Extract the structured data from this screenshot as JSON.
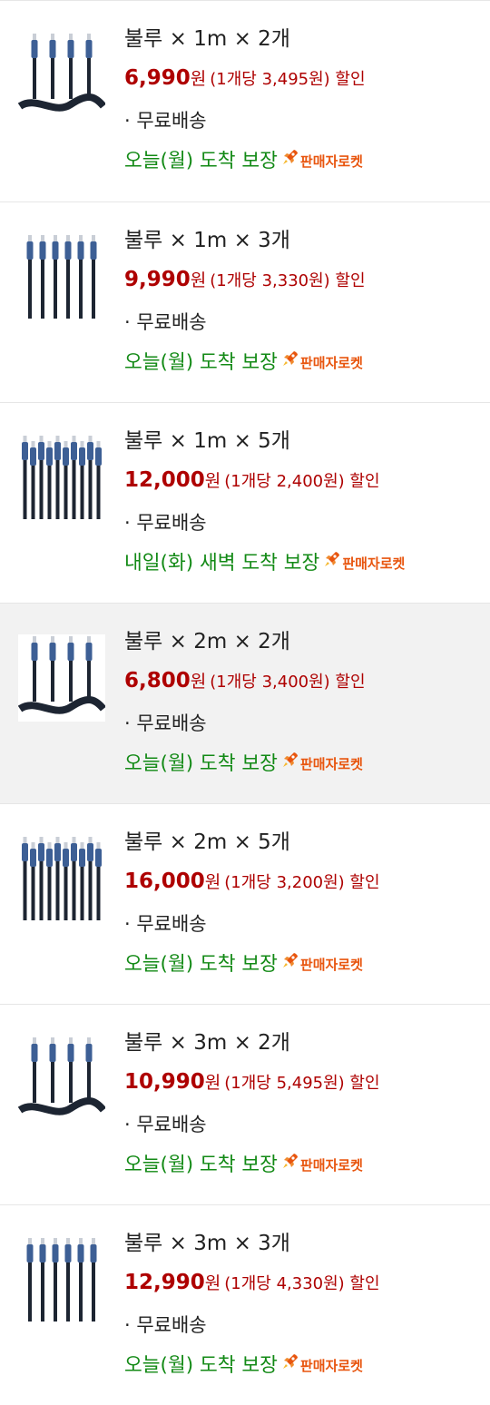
{
  "options": [
    {
      "title": "불루 × 1m × 2개",
      "price": "6,990",
      "currency": "원",
      "unit_price": "(1개당 3,495원) 할인",
      "shipping": "· 무료배송",
      "arrival": "오늘(월) 도착 보장",
      "badge": "판매자로켓",
      "selected": false,
      "cables": 4
    },
    {
      "title": "불루 × 1m × 3개",
      "price": "9,990",
      "currency": "원",
      "unit_price": "(1개당 3,330원) 할인",
      "shipping": "· 무료배송",
      "arrival": "오늘(월) 도착 보장",
      "badge": "판매자로켓",
      "selected": false,
      "cables": 6
    },
    {
      "title": "불루 × 1m × 5개",
      "price": "12,000",
      "currency": "원",
      "unit_price": "(1개당 2,400원) 할인",
      "shipping": "· 무료배송",
      "arrival": "내일(화) 새벽 도착 보장",
      "badge": "판매자로켓",
      "selected": false,
      "cables": 10
    },
    {
      "title": "불루 × 2m × 2개",
      "price": "6,800",
      "currency": "원",
      "unit_price": "(1개당 3,400원) 할인",
      "shipping": "· 무료배송",
      "arrival": "오늘(월) 도착 보장",
      "badge": "판매자로켓",
      "selected": true,
      "cables": 4
    },
    {
      "title": "불루 × 2m × 5개",
      "price": "16,000",
      "currency": "원",
      "unit_price": "(1개당 3,200원) 할인",
      "shipping": "· 무료배송",
      "arrival": "오늘(월) 도착 보장",
      "badge": "판매자로켓",
      "selected": false,
      "cables": 10
    },
    {
      "title": "불루 × 3m × 2개",
      "price": "10,990",
      "currency": "원",
      "unit_price": "(1개당 5,495원) 할인",
      "shipping": "· 무료배송",
      "arrival": "오늘(월) 도착 보장",
      "badge": "판매자로켓",
      "selected": false,
      "cables": 4
    },
    {
      "title": "불루 × 3m × 3개",
      "price": "12,990",
      "currency": "원",
      "unit_price": "(1개당 4,330원) 할인",
      "shipping": "· 무료배송",
      "arrival": "오늘(월) 도착 보장",
      "badge": "판매자로켓",
      "selected": false,
      "cables": 6
    }
  ],
  "colors": {
    "price": "#ae0000",
    "arrival": "#138a16",
    "rocket": "#e8550e",
    "selected_bg": "#f2f2f2",
    "cable_connector": "#3d5f95",
    "cable_body": "#1d2532"
  },
  "icons": {
    "product_thumb": "usb-c-cable-bundle-icon",
    "badge": "rocket-icon"
  }
}
